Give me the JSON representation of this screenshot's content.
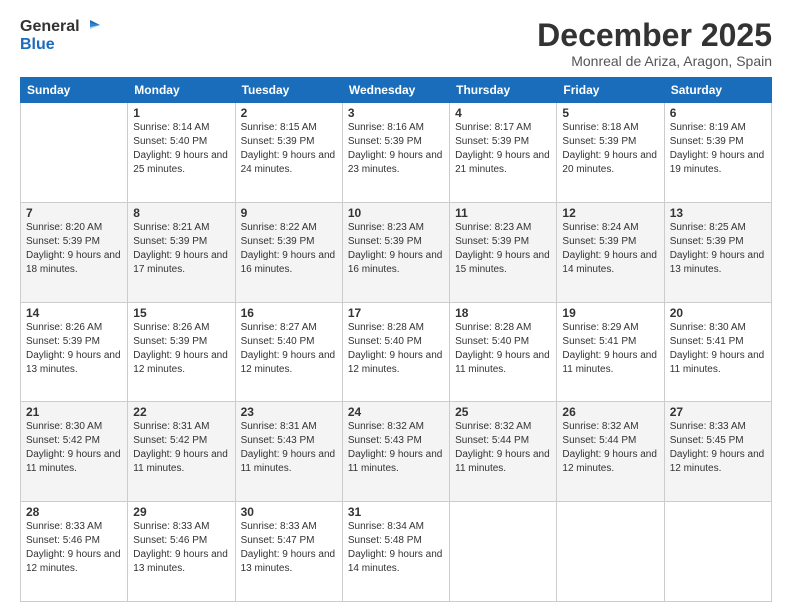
{
  "header": {
    "logo_line1": "General",
    "logo_line2": "Blue",
    "month": "December 2025",
    "location": "Monreal de Ariza, Aragon, Spain"
  },
  "days_of_week": [
    "Sunday",
    "Monday",
    "Tuesday",
    "Wednesday",
    "Thursday",
    "Friday",
    "Saturday"
  ],
  "weeks": [
    [
      {
        "day": "",
        "sunrise": "",
        "sunset": "",
        "daylight": ""
      },
      {
        "day": "1",
        "sunrise": "Sunrise: 8:14 AM",
        "sunset": "Sunset: 5:40 PM",
        "daylight": "Daylight: 9 hours and 25 minutes."
      },
      {
        "day": "2",
        "sunrise": "Sunrise: 8:15 AM",
        "sunset": "Sunset: 5:39 PM",
        "daylight": "Daylight: 9 hours and 24 minutes."
      },
      {
        "day": "3",
        "sunrise": "Sunrise: 8:16 AM",
        "sunset": "Sunset: 5:39 PM",
        "daylight": "Daylight: 9 hours and 23 minutes."
      },
      {
        "day": "4",
        "sunrise": "Sunrise: 8:17 AM",
        "sunset": "Sunset: 5:39 PM",
        "daylight": "Daylight: 9 hours and 21 minutes."
      },
      {
        "day": "5",
        "sunrise": "Sunrise: 8:18 AM",
        "sunset": "Sunset: 5:39 PM",
        "daylight": "Daylight: 9 hours and 20 minutes."
      },
      {
        "day": "6",
        "sunrise": "Sunrise: 8:19 AM",
        "sunset": "Sunset: 5:39 PM",
        "daylight": "Daylight: 9 hours and 19 minutes."
      }
    ],
    [
      {
        "day": "7",
        "sunrise": "Sunrise: 8:20 AM",
        "sunset": "Sunset: 5:39 PM",
        "daylight": "Daylight: 9 hours and 18 minutes."
      },
      {
        "day": "8",
        "sunrise": "Sunrise: 8:21 AM",
        "sunset": "Sunset: 5:39 PM",
        "daylight": "Daylight: 9 hours and 17 minutes."
      },
      {
        "day": "9",
        "sunrise": "Sunrise: 8:22 AM",
        "sunset": "Sunset: 5:39 PM",
        "daylight": "Daylight: 9 hours and 16 minutes."
      },
      {
        "day": "10",
        "sunrise": "Sunrise: 8:23 AM",
        "sunset": "Sunset: 5:39 PM",
        "daylight": "Daylight: 9 hours and 16 minutes."
      },
      {
        "day": "11",
        "sunrise": "Sunrise: 8:23 AM",
        "sunset": "Sunset: 5:39 PM",
        "daylight": "Daylight: 9 hours and 15 minutes."
      },
      {
        "day": "12",
        "sunrise": "Sunrise: 8:24 AM",
        "sunset": "Sunset: 5:39 PM",
        "daylight": "Daylight: 9 hours and 14 minutes."
      },
      {
        "day": "13",
        "sunrise": "Sunrise: 8:25 AM",
        "sunset": "Sunset: 5:39 PM",
        "daylight": "Daylight: 9 hours and 13 minutes."
      }
    ],
    [
      {
        "day": "14",
        "sunrise": "Sunrise: 8:26 AM",
        "sunset": "Sunset: 5:39 PM",
        "daylight": "Daylight: 9 hours and 13 minutes."
      },
      {
        "day": "15",
        "sunrise": "Sunrise: 8:26 AM",
        "sunset": "Sunset: 5:39 PM",
        "daylight": "Daylight: 9 hours and 12 minutes."
      },
      {
        "day": "16",
        "sunrise": "Sunrise: 8:27 AM",
        "sunset": "Sunset: 5:40 PM",
        "daylight": "Daylight: 9 hours and 12 minutes."
      },
      {
        "day": "17",
        "sunrise": "Sunrise: 8:28 AM",
        "sunset": "Sunset: 5:40 PM",
        "daylight": "Daylight: 9 hours and 12 minutes."
      },
      {
        "day": "18",
        "sunrise": "Sunrise: 8:28 AM",
        "sunset": "Sunset: 5:40 PM",
        "daylight": "Daylight: 9 hours and 11 minutes."
      },
      {
        "day": "19",
        "sunrise": "Sunrise: 8:29 AM",
        "sunset": "Sunset: 5:41 PM",
        "daylight": "Daylight: 9 hours and 11 minutes."
      },
      {
        "day": "20",
        "sunrise": "Sunrise: 8:30 AM",
        "sunset": "Sunset: 5:41 PM",
        "daylight": "Daylight: 9 hours and 11 minutes."
      }
    ],
    [
      {
        "day": "21",
        "sunrise": "Sunrise: 8:30 AM",
        "sunset": "Sunset: 5:42 PM",
        "daylight": "Daylight: 9 hours and 11 minutes."
      },
      {
        "day": "22",
        "sunrise": "Sunrise: 8:31 AM",
        "sunset": "Sunset: 5:42 PM",
        "daylight": "Daylight: 9 hours and 11 minutes."
      },
      {
        "day": "23",
        "sunrise": "Sunrise: 8:31 AM",
        "sunset": "Sunset: 5:43 PM",
        "daylight": "Daylight: 9 hours and 11 minutes."
      },
      {
        "day": "24",
        "sunrise": "Sunrise: 8:32 AM",
        "sunset": "Sunset: 5:43 PM",
        "daylight": "Daylight: 9 hours and 11 minutes."
      },
      {
        "day": "25",
        "sunrise": "Sunrise: 8:32 AM",
        "sunset": "Sunset: 5:44 PM",
        "daylight": "Daylight: 9 hours and 11 minutes."
      },
      {
        "day": "26",
        "sunrise": "Sunrise: 8:32 AM",
        "sunset": "Sunset: 5:44 PM",
        "daylight": "Daylight: 9 hours and 12 minutes."
      },
      {
        "day": "27",
        "sunrise": "Sunrise: 8:33 AM",
        "sunset": "Sunset: 5:45 PM",
        "daylight": "Daylight: 9 hours and 12 minutes."
      }
    ],
    [
      {
        "day": "28",
        "sunrise": "Sunrise: 8:33 AM",
        "sunset": "Sunset: 5:46 PM",
        "daylight": "Daylight: 9 hours and 12 minutes."
      },
      {
        "day": "29",
        "sunrise": "Sunrise: 8:33 AM",
        "sunset": "Sunset: 5:46 PM",
        "daylight": "Daylight: 9 hours and 13 minutes."
      },
      {
        "day": "30",
        "sunrise": "Sunrise: 8:33 AM",
        "sunset": "Sunset: 5:47 PM",
        "daylight": "Daylight: 9 hours and 13 minutes."
      },
      {
        "day": "31",
        "sunrise": "Sunrise: 8:34 AM",
        "sunset": "Sunset: 5:48 PM",
        "daylight": "Daylight: 9 hours and 14 minutes."
      },
      {
        "day": "",
        "sunrise": "",
        "sunset": "",
        "daylight": ""
      },
      {
        "day": "",
        "sunrise": "",
        "sunset": "",
        "daylight": ""
      },
      {
        "day": "",
        "sunrise": "",
        "sunset": "",
        "daylight": ""
      }
    ]
  ]
}
